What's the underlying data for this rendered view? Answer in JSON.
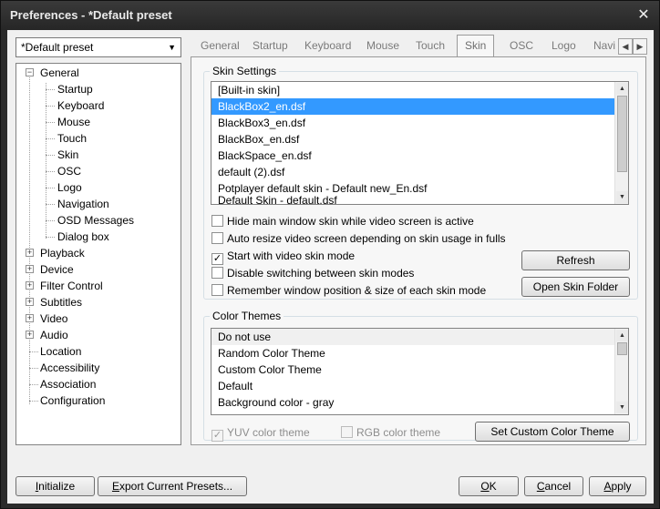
{
  "window": {
    "title": "Preferences - *Default preset",
    "close_glyph": "✕"
  },
  "preset": {
    "value": "*Default preset"
  },
  "tree": {
    "general": "General",
    "general_children": [
      "Startup",
      "Keyboard",
      "Mouse",
      "Touch",
      "Skin",
      "OSC",
      "Logo",
      "Navigation",
      "OSD Messages",
      "Dialog box"
    ],
    "collapsed": [
      "Playback",
      "Device",
      "Filter Control",
      "Subtitles",
      "Video",
      "Audio"
    ],
    "leaves": [
      "Location",
      "Accessibility",
      "Association",
      "Configuration"
    ]
  },
  "tabs": [
    "General",
    "Startup",
    "Keyboard",
    "Mouse",
    "Touch",
    "Skin",
    "OSC",
    "Logo",
    "Navi"
  ],
  "skin_settings": {
    "title": "Skin Settings",
    "items": [
      "[Built-in skin]",
      "BlackBox2_en.dsf",
      "BlackBox3_en.dsf",
      "BlackBox_en.dsf",
      "BlackSpace_en.dsf",
      "default (2).dsf",
      "Potplayer default skin - Default new_En.dsf",
      "Default Skin - default.dsf"
    ],
    "selected_index": 1,
    "options": [
      {
        "label": "Hide main window skin while video screen is active",
        "checked": false
      },
      {
        "label": "Auto resize video screen depending on skin usage in fullscreen",
        "checked": false
      },
      {
        "label": "Start with video skin mode",
        "checked": true
      },
      {
        "label": "Disable switching between skin modes",
        "checked": false
      },
      {
        "label": "Remember window position & size of each skin mode",
        "checked": false
      }
    ],
    "refresh_label": "Refresh",
    "open_folder_label": "Open Skin Folder"
  },
  "color_themes": {
    "title": "Color Themes",
    "items": [
      "Do not use",
      "Random Color Theme",
      "Custom Color Theme",
      "Default",
      "Background color - gray"
    ],
    "yuv_label": "YUV color theme",
    "rgb_label": "RGB color theme",
    "set_custom_label": "Set Custom Color Theme"
  },
  "footer": {
    "initialize_first": "I",
    "initialize_rest": "nitialize",
    "export_first": "E",
    "export_rest": "xport Current Presets...",
    "ok_first": "O",
    "ok_rest": "K",
    "cancel_first": "C",
    "cancel_rest": "ancel",
    "apply_first": "A",
    "apply_rest": "pply"
  }
}
